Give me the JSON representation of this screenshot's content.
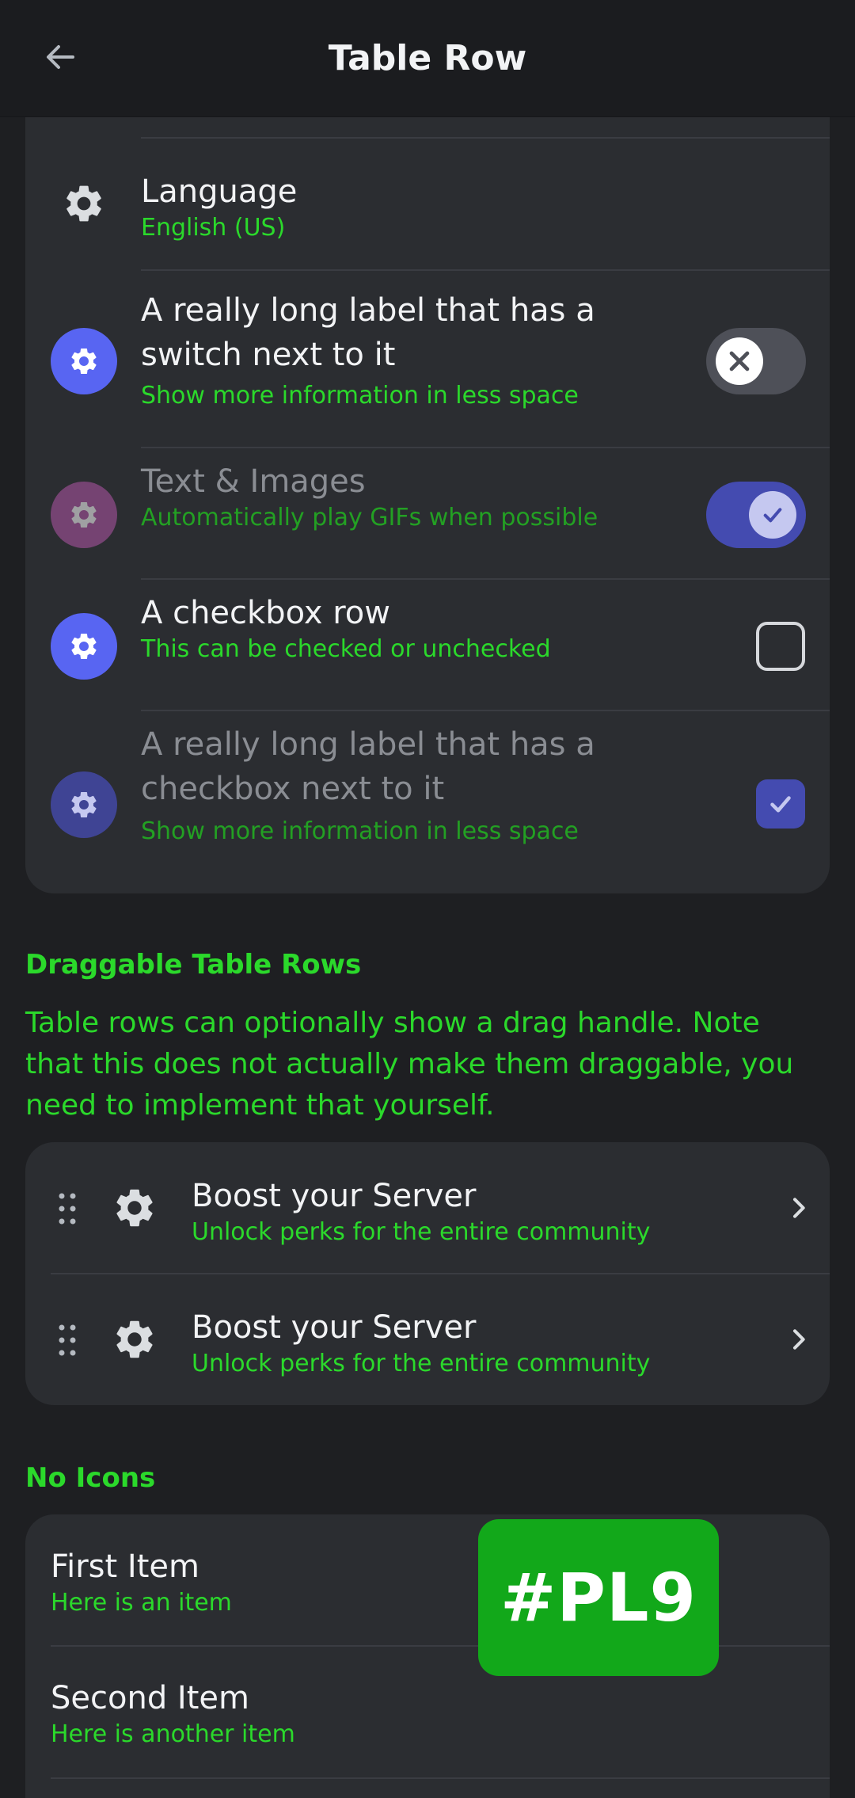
{
  "header": {
    "title": "Table Row",
    "back_icon": "arrow-left-icon"
  },
  "section1": {
    "rows": [
      {
        "label": "Language",
        "subtitle": "English (US)",
        "icon": "gear-icon"
      },
      {
        "label_line1": "A really long label that has a",
        "label_line2": "switch next to it",
        "subtitle": "Show more information in less space",
        "icon": "gear-icon",
        "icon_color": "#5865f2",
        "switch_state": "off"
      },
      {
        "label": "Text & Images",
        "subtitle": "Automatically play GIFs when possible",
        "icon": "gear-icon",
        "icon_color": "#b256a8",
        "switch_state": "on",
        "disabled": true
      },
      {
        "label": "A checkbox row",
        "subtitle": "This can be checked or unchecked",
        "icon": "gear-icon",
        "icon_color": "#5865f2",
        "checked": false
      },
      {
        "label_line1": "A really long label that has a",
        "label_line2": "checkbox next to it",
        "subtitle": "Show more information in less space",
        "icon": "gear-icon",
        "icon_color": "#3f4494",
        "checked": true,
        "disabled": true
      }
    ]
  },
  "draggable": {
    "title": "Draggable Table Rows",
    "description": "Table rows can optionally show a drag handle. Note that this does not actually make them draggable, you need to implement that yourself.",
    "rows": [
      {
        "label": "Boost your Server",
        "subtitle": "Unlock perks for the entire community",
        "icon": "gear-icon"
      },
      {
        "label": "Boost your Server",
        "subtitle": "Unlock perks for the entire community",
        "icon": "gear-icon"
      }
    ]
  },
  "no_icons": {
    "title": "No Icons",
    "rows": [
      {
        "label": "First Item",
        "subtitle": "Here is an item"
      },
      {
        "label": "Second Item",
        "subtitle": "Here is another item"
      }
    ]
  },
  "badge": {
    "text": "#PL9"
  },
  "colors": {
    "accent_green": "#2bd92b",
    "brand": "#5865f2",
    "card_bg": "#2b2d31",
    "page_bg": "#1e1f22"
  }
}
